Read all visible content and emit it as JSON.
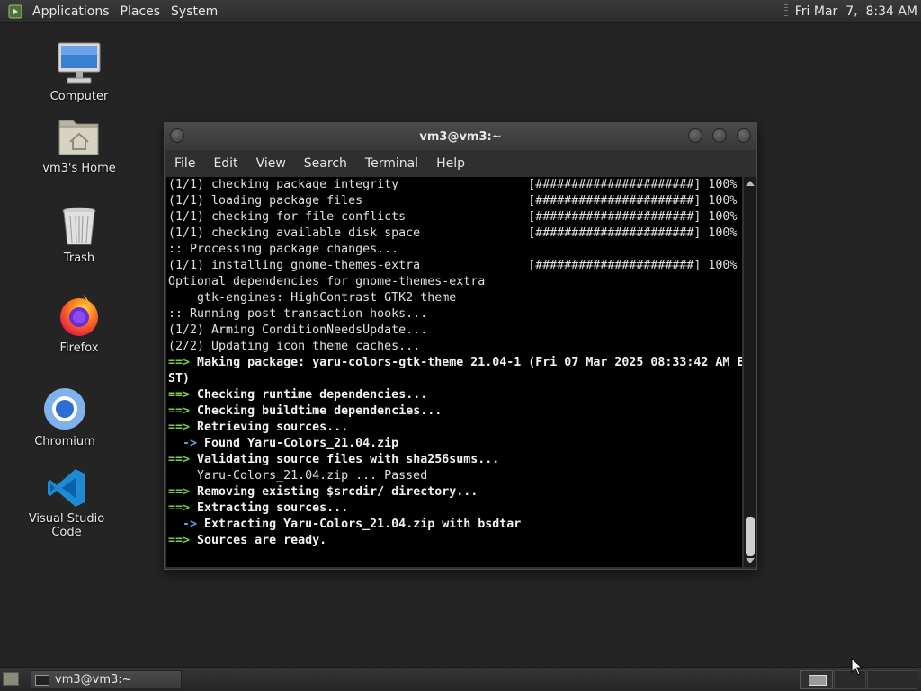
{
  "top_panel": {
    "menus": [
      "Applications",
      "Places",
      "System"
    ],
    "clock": "Fri Mar  7,  8:34 AM"
  },
  "desktop_icons": [
    {
      "label": "Computer",
      "icon": "computer-icon"
    },
    {
      "label": "vm3's Home",
      "icon": "home-folder-icon"
    },
    {
      "label": "Trash",
      "icon": "trash-icon"
    },
    {
      "label": "Firefox",
      "icon": "firefox-icon"
    },
    {
      "label": "Chromium",
      "icon": "chromium-icon"
    },
    {
      "label": "Visual Studio Code",
      "icon": "vscode-icon"
    }
  ],
  "terminal": {
    "title": "vm3@vm3:~",
    "menu": [
      "File",
      "Edit",
      "View",
      "Search",
      "Terminal",
      "Help"
    ],
    "lines": [
      {
        "style": "plain",
        "text": "(1/1) checking package integrity                  [######################] 100%"
      },
      {
        "style": "plain",
        "text": "(1/1) loading package files                       [######################] 100%"
      },
      {
        "style": "plain",
        "text": "(1/1) checking for file conflicts                 [######################] 100%"
      },
      {
        "style": "plain",
        "text": "(1/1) checking available disk space               [######################] 100%"
      },
      {
        "style": "plain",
        "text": ":: Processing package changes..."
      },
      {
        "style": "plain",
        "text": "(1/1) installing gnome-themes-extra               [######################] 100%"
      },
      {
        "style": "plain",
        "text": "Optional dependencies for gnome-themes-extra"
      },
      {
        "style": "plain",
        "text": "    gtk-engines: HighContrast GTK2 theme"
      },
      {
        "style": "plain",
        "text": ":: Running post-transaction hooks..."
      },
      {
        "style": "plain",
        "text": "(1/2) Arming ConditionNeedsUpdate..."
      },
      {
        "style": "plain",
        "text": "(2/2) Updating icon theme caches..."
      },
      {
        "style": "arrow",
        "prefix": "==>",
        "text": " Making package: yaru-colors-gtk-theme 21.04-1 (Fri 07 Mar 2025 08:33:42 AM E"
      },
      {
        "style": "bold",
        "text": "ST)"
      },
      {
        "style": "arrow",
        "prefix": "==>",
        "text": " Checking runtime dependencies..."
      },
      {
        "style": "arrow",
        "prefix": "==>",
        "text": " Checking buildtime dependencies..."
      },
      {
        "style": "arrow",
        "prefix": "==>",
        "text": " Retrieving sources..."
      },
      {
        "style": "sub",
        "prefix": "  ->",
        "text": " Found Yaru-Colors_21.04.zip"
      },
      {
        "style": "arrow",
        "prefix": "==>",
        "text": " Validating source files with sha256sums..."
      },
      {
        "style": "plain",
        "text": "    Yaru-Colors_21.04.zip ... Passed"
      },
      {
        "style": "arrow",
        "prefix": "==>",
        "text": " Removing existing $srcdir/ directory..."
      },
      {
        "style": "arrow",
        "prefix": "==>",
        "text": " Extracting sources..."
      },
      {
        "style": "sub",
        "prefix": "  ->",
        "text": " Extracting Yaru-Colors_21.04.zip with bsdtar"
      },
      {
        "style": "arrow",
        "prefix": "==>",
        "text": " Sources are ready."
      }
    ]
  },
  "taskbar": {
    "task_label": "vm3@vm3:~"
  }
}
